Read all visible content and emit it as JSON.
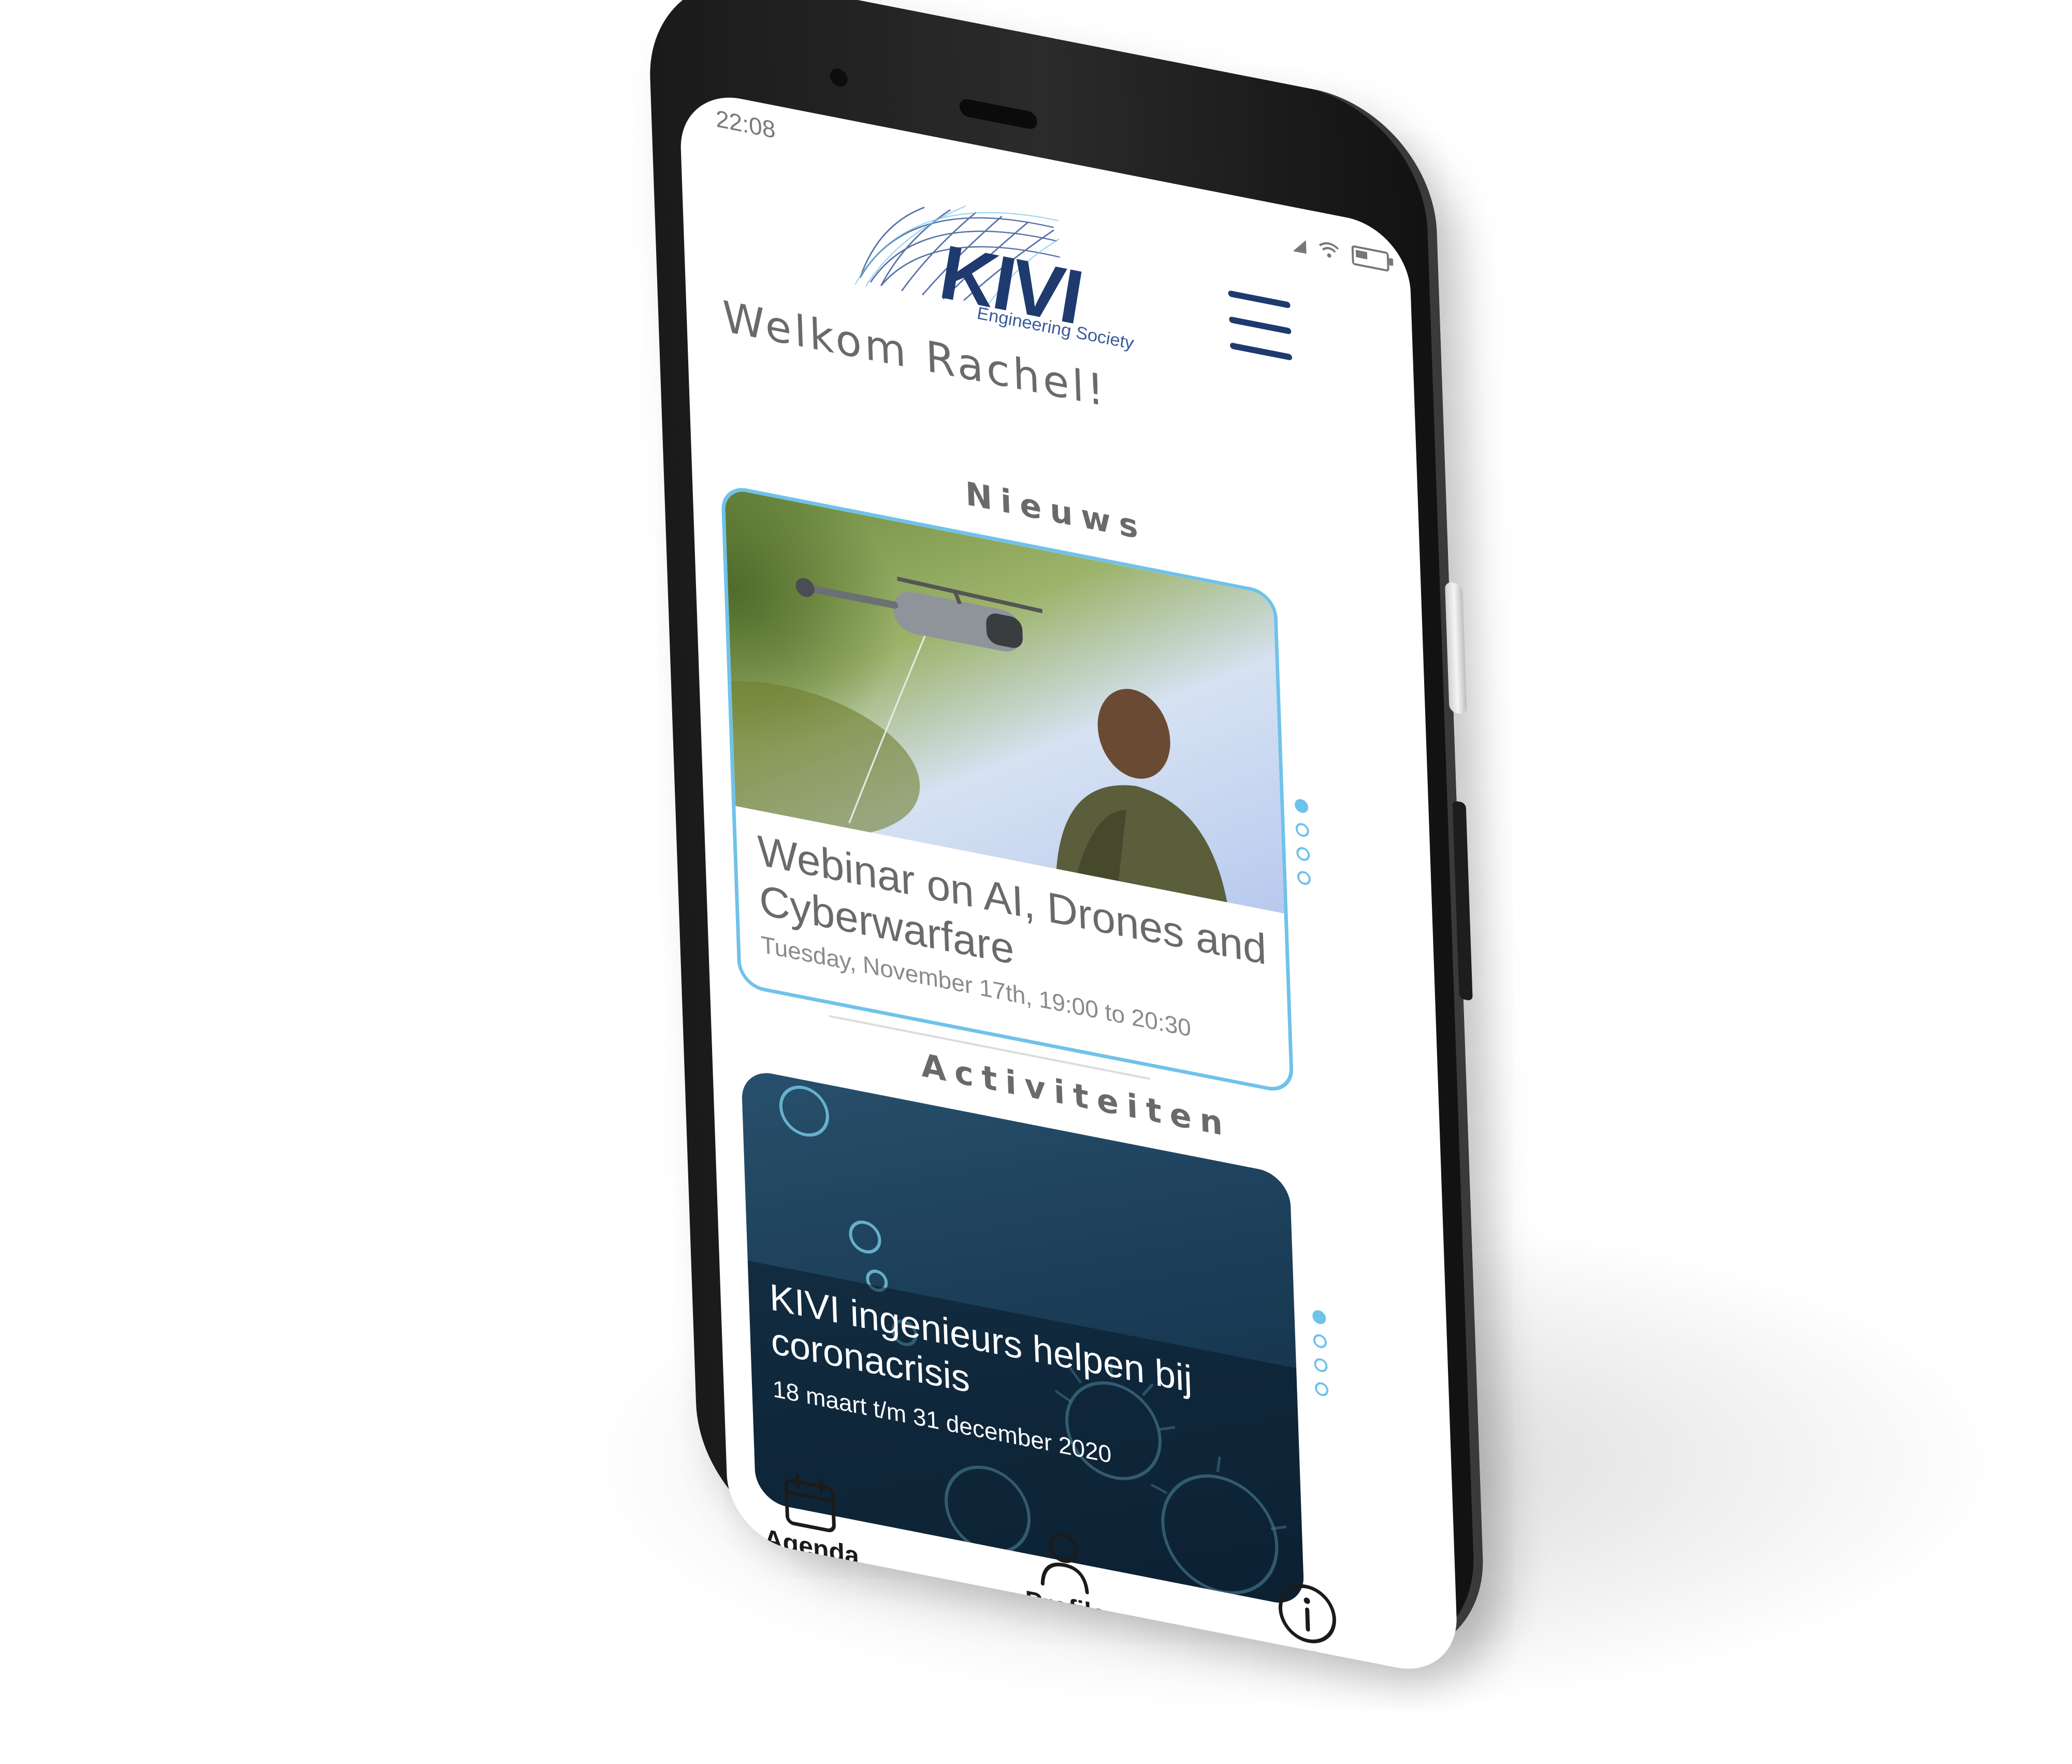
{
  "status_bar": {
    "time": "22:08",
    "icons": [
      "signal-icon",
      "wifi-icon",
      "battery-icon"
    ]
  },
  "header": {
    "logo_text": "KIVI",
    "logo_subtitle": "Engineering Society",
    "menu_icon": "hamburger-menu-icon"
  },
  "welcome": {
    "text": "Welkom Rachel!"
  },
  "news": {
    "section_title": "Nieuws",
    "card": {
      "headline": "Webinar on AI,  Drones and Cyberwarfare",
      "date": "Tuesday, November 17th, 19:00 to 20:30"
    },
    "carousel": {
      "count": 4,
      "active_index": 0
    }
  },
  "activities": {
    "section_title": "Activiteiten",
    "card": {
      "headline": "KIVI ingenieurs helpen bij coronacrisis",
      "date": "18 maart t/m 31 december 2020"
    },
    "carousel": {
      "count": 4,
      "active_index": 0
    }
  },
  "tabbar": {
    "items": [
      {
        "label": "Agenda",
        "icon": "calendar-icon"
      },
      {
        "label": "Profile",
        "icon": "person-icon"
      },
      {
        "label": "Info",
        "icon": "info-icon"
      }
    ]
  },
  "colors": {
    "brand_navy": "#1f3a6e",
    "accent_light_blue": "#6fc3ea",
    "text_gray": "#6a6a6a",
    "phone_body": "#1a1a1a"
  }
}
